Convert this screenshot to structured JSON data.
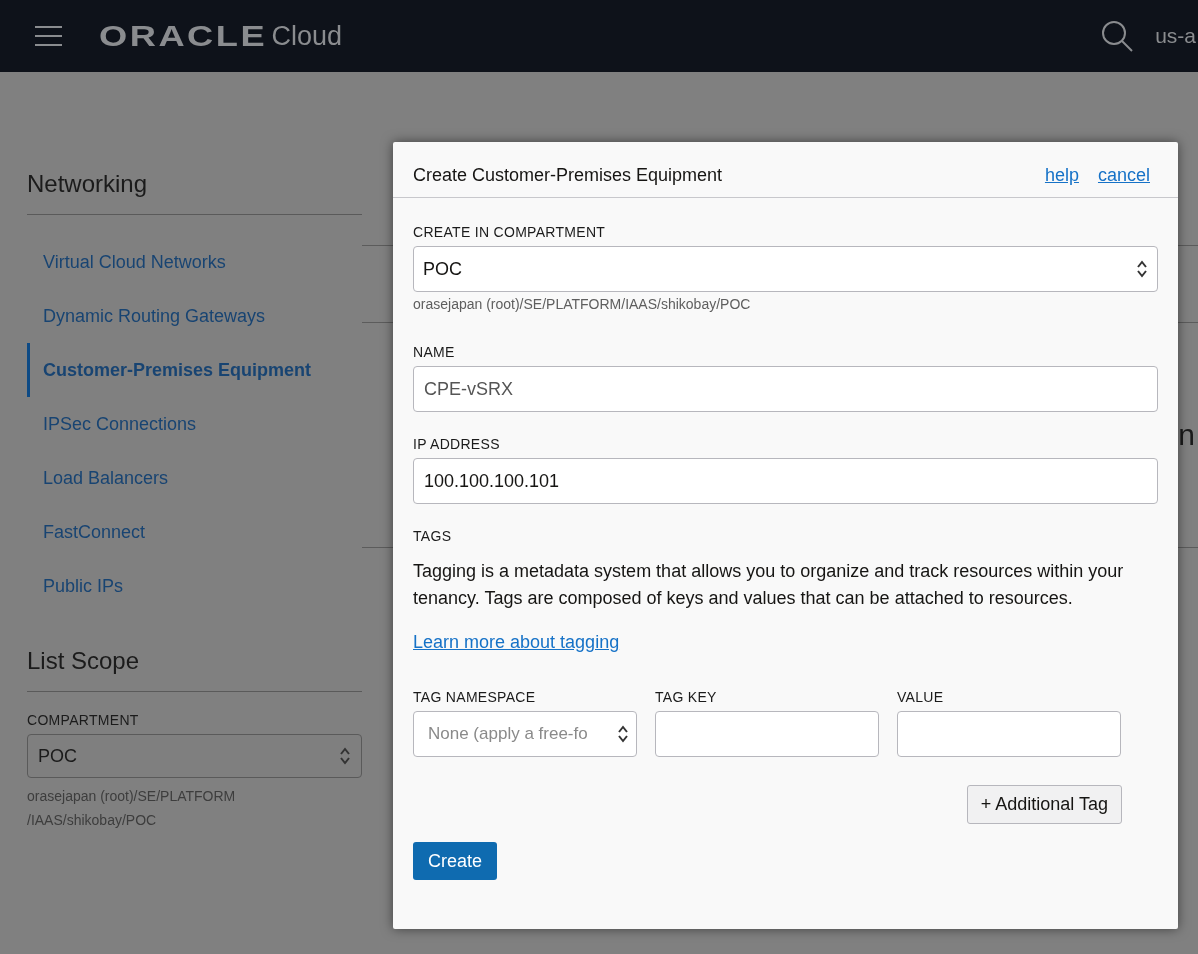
{
  "header": {
    "logo_brand": "ORACLE",
    "logo_product": "Cloud",
    "region": "us-a"
  },
  "sidebar": {
    "title": "Networking",
    "items": [
      {
        "label": "Virtual Cloud Networks",
        "selected": false
      },
      {
        "label": "Dynamic Routing Gateways",
        "selected": false
      },
      {
        "label": "Customer-Premises Equipment",
        "selected": true
      },
      {
        "label": "IPSec Connections",
        "selected": false
      },
      {
        "label": "Load Balancers",
        "selected": false
      },
      {
        "label": "FastConnect",
        "selected": false
      },
      {
        "label": "Public IPs",
        "selected": false
      }
    ],
    "list_scope": {
      "title": "List Scope",
      "compartment_label": "COMPARTMENT",
      "compartment_value": "POC",
      "compartment_path": "orasejapan (root)/SE/PLATFORM /IAAS/shikobay/POC"
    }
  },
  "page_heading_fragment": "n",
  "dialog": {
    "title": "Create Customer-Premises Equipment",
    "help": "help",
    "cancel": "cancel",
    "compartment": {
      "label": "CREATE IN COMPARTMENT",
      "value": "POC",
      "path": "orasejapan (root)/SE/PLATFORM/IAAS/shikobay/POC"
    },
    "name": {
      "label": "NAME",
      "value": "CPE-vSRX"
    },
    "ip_address": {
      "label": "IP ADDRESS",
      "value": "100.100.100.101"
    },
    "tags": {
      "label": "TAGS",
      "description": "Tagging is a metadata system that allows you to organize and track resources within your tenancy. Tags are composed of keys and values that can be attached to resources.",
      "learn_more": "Learn more about tagging",
      "namespace": {
        "label": "TAG NAMESPACE",
        "placeholder": "None (apply a free-fo"
      },
      "key": {
        "label": "TAG KEY"
      },
      "value": {
        "label": "VALUE"
      },
      "add_button": "+ Additional Tag"
    },
    "create_button": "Create"
  }
}
